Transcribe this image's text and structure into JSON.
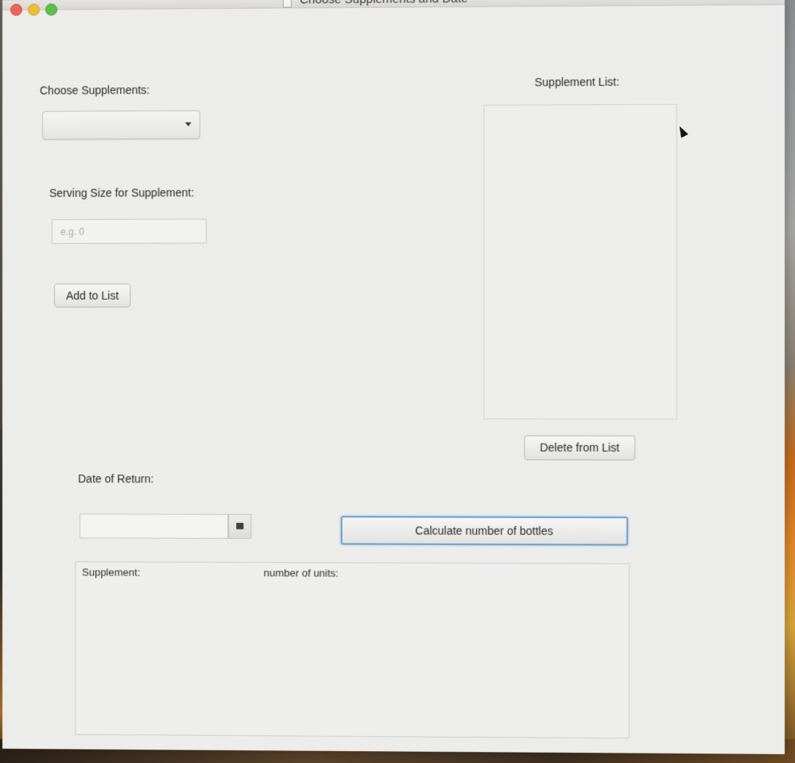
{
  "window": {
    "title": "Choose Supplements and Date"
  },
  "supplements": {
    "label": "Choose Supplements:",
    "selected": ""
  },
  "serving": {
    "label": "Serving Size for Supplement:",
    "placeholder": "e.g. 0",
    "value": ""
  },
  "buttons": {
    "add_to_list": "Add to List",
    "delete_from_list": "Delete from List",
    "calculate": "Calculate number of bottles"
  },
  "supplement_list": {
    "label": "Supplement List:",
    "items": []
  },
  "date": {
    "label": "Date of Return:",
    "value": ""
  },
  "results": {
    "columns": [
      "Supplement:",
      "number of units:"
    ],
    "rows": []
  },
  "icons": {
    "close": "close-icon",
    "minimize": "minimize-icon",
    "zoom": "zoom-icon",
    "dropdown": "chevron-down-icon",
    "calendar": "calendar-icon",
    "document": "document-icon",
    "cursor": "mouse-pointer-icon"
  },
  "colors": {
    "focus_ring": "#6a9fd2",
    "close": "#ec6559",
    "minimize": "#e7bf3a",
    "zoom": "#5dbf4a"
  }
}
